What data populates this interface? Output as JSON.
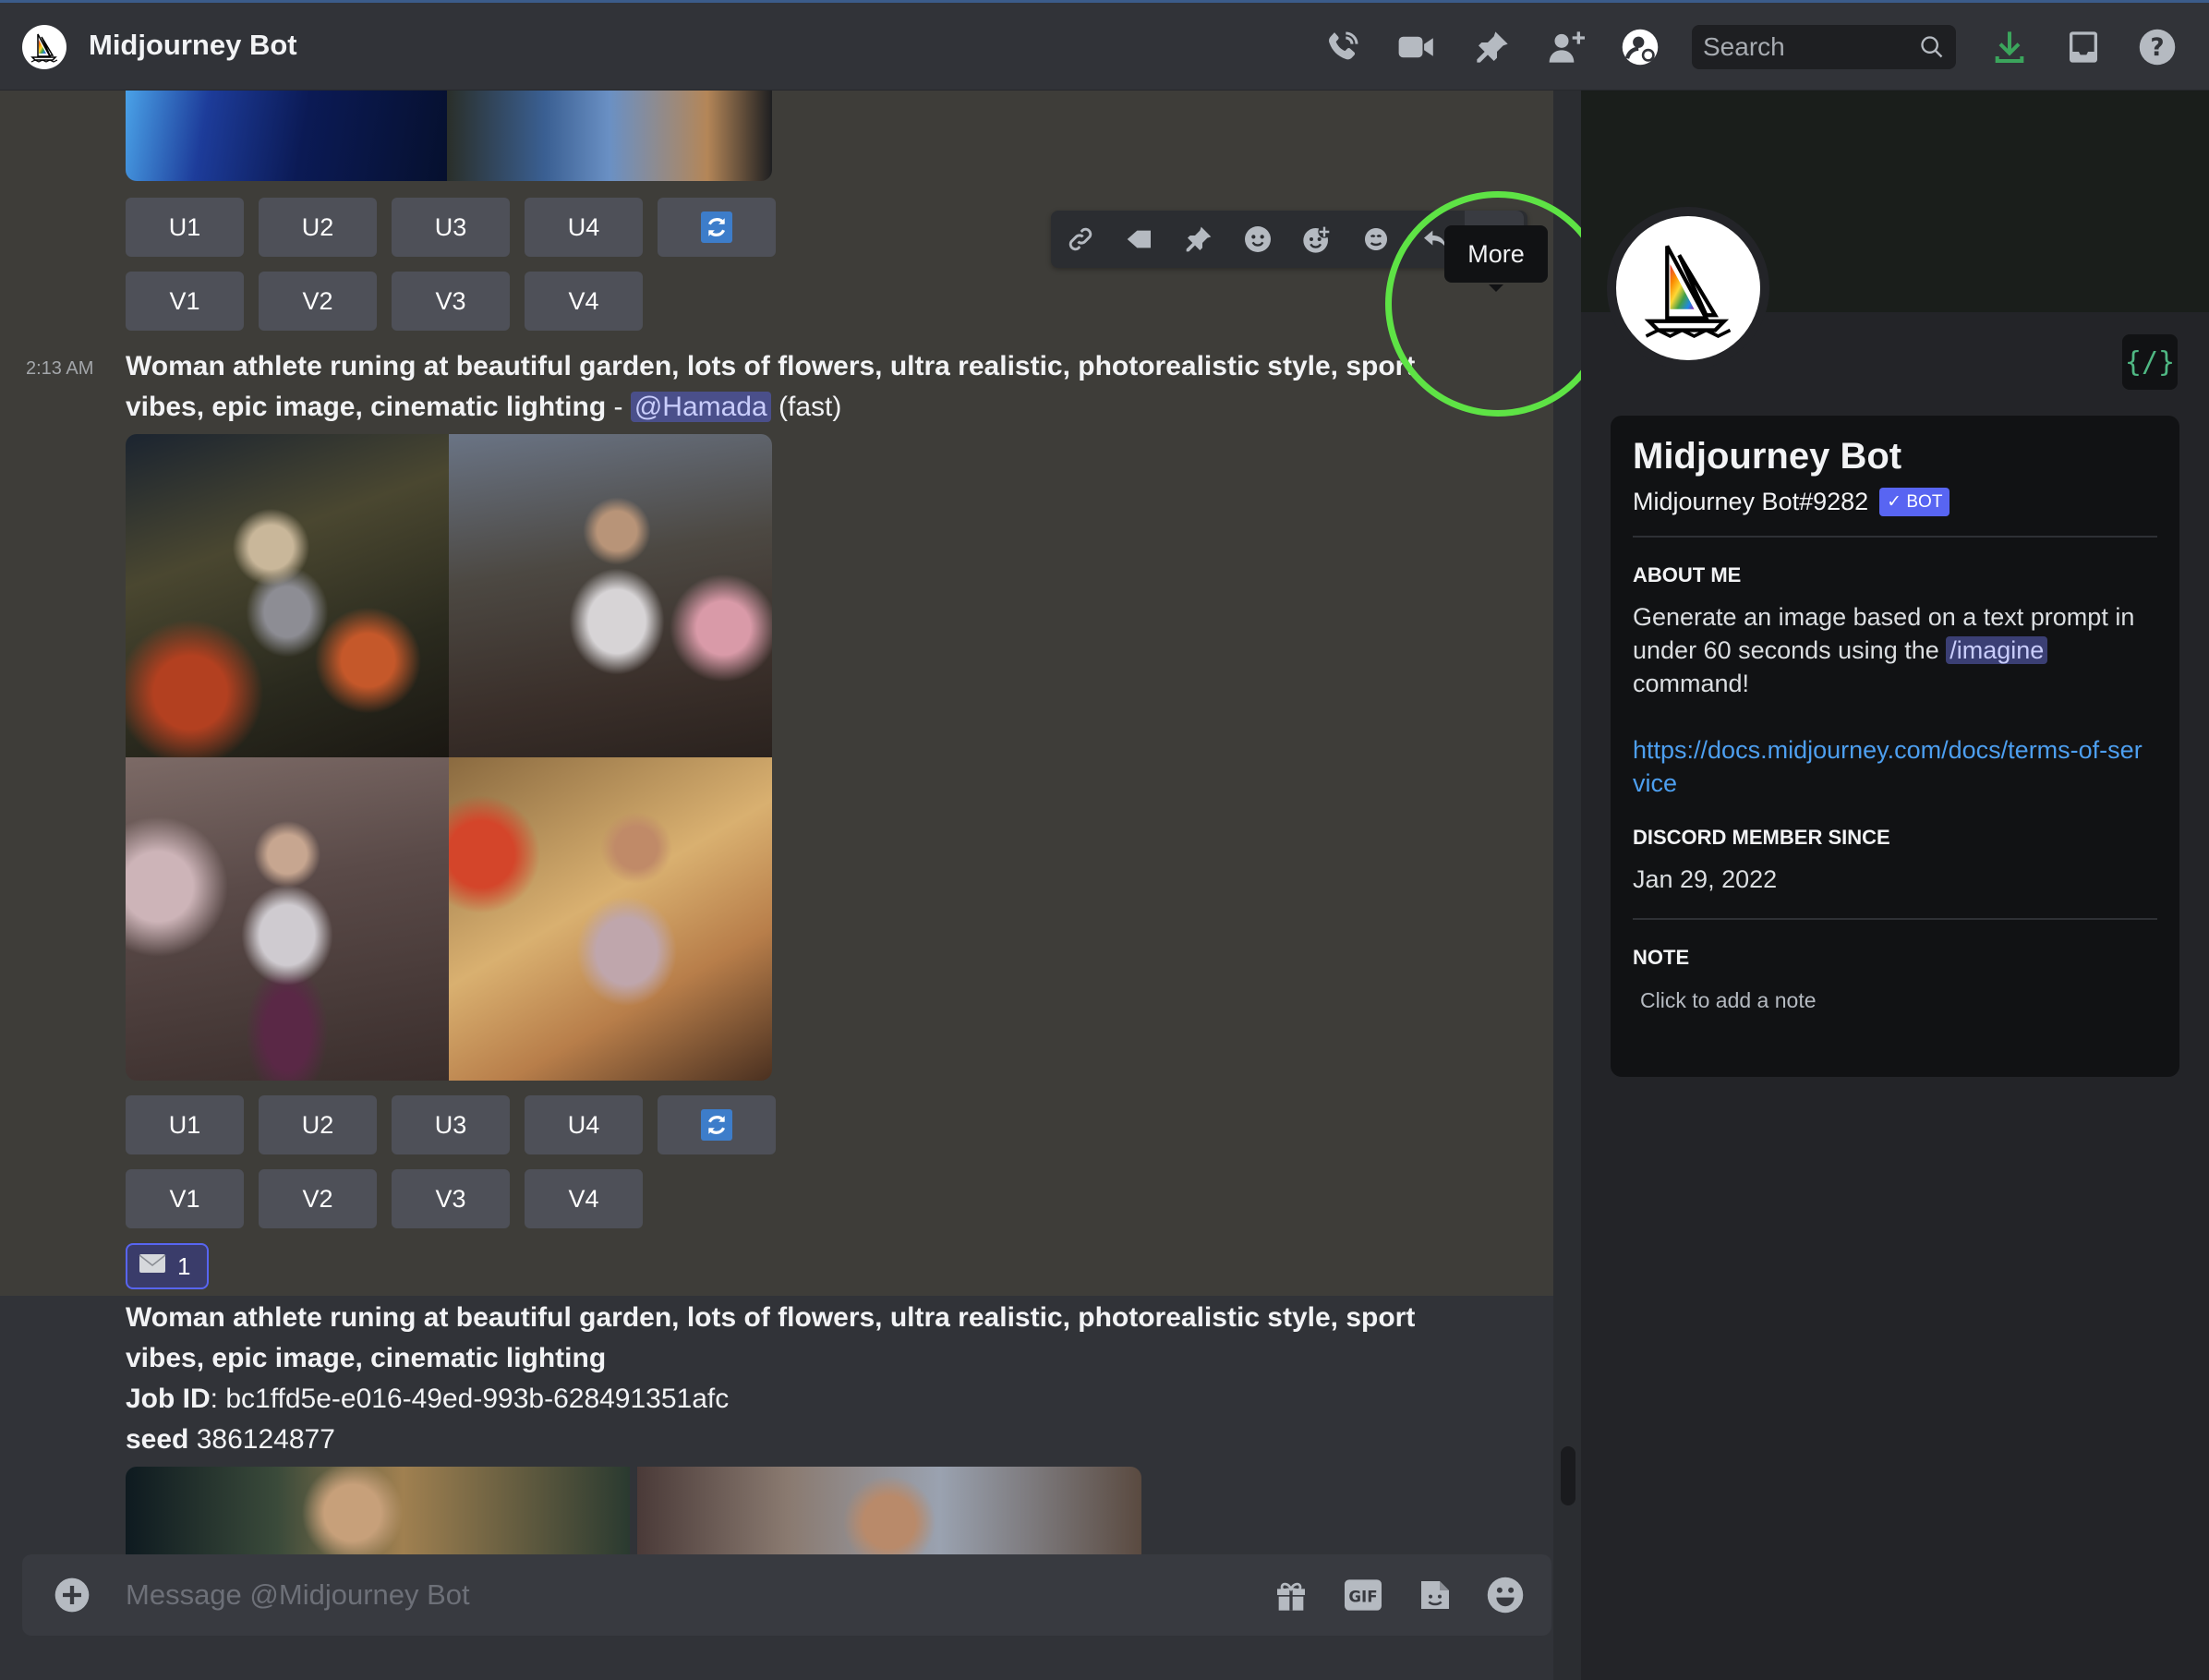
{
  "header": {
    "title": "Midjourney Bot",
    "search_placeholder": "Search",
    "icons": [
      "voice-call-icon",
      "video-call-icon",
      "pinned-messages-icon",
      "add-friend-icon",
      "user-profile-icon",
      "download-icon",
      "inbox-icon",
      "help-icon"
    ],
    "accent_download": "#3ba55c"
  },
  "messages": [
    {
      "id": "prev",
      "buttons_upscale": [
        "U1",
        "U2",
        "U3",
        "U4"
      ],
      "buttons_variation": [
        "V1",
        "V2",
        "V3",
        "V4"
      ],
      "reroll_icon": "reroll-icon"
    },
    {
      "id": "current",
      "timestamp": "2:13 AM",
      "prompt_line1": "Woman athlete runing at beautiful garden, lots of flowers, ultra realistic, photorealistic style, sport",
      "prompt_line2": "vibes, epic image, cinematic lighting",
      "separator": " - ",
      "mention": "@Hamada",
      "mode": "(fast)",
      "buttons_upscale": [
        "U1",
        "U2",
        "U3",
        "U4"
      ],
      "buttons_variation": [
        "V1",
        "V2",
        "V3",
        "V4"
      ],
      "reaction": {
        "icon": "envelope-icon",
        "count": "1"
      }
    },
    {
      "id": "next",
      "prompt_line1": "Woman athlete runing at beautiful garden, lots of flowers, ultra realistic, photorealistic style, sport",
      "prompt_line2": "vibes, epic image, cinematic lighting",
      "job_label": "Job ID",
      "job_id": ": bc1ffd5e-e016-49ed-993b-628491351afc",
      "seed_label": "seed",
      "seed": " 386124877"
    }
  ],
  "hover_toolbar": {
    "icons": [
      "copy-link-icon",
      "mark-unread-icon",
      "pin-icon",
      "add-reaction-icon",
      "super-reaction-icon",
      "apps-icon",
      "reply-icon",
      "more-icon"
    ],
    "tooltip": "More"
  },
  "composer": {
    "placeholder": "Message @Midjourney Bot",
    "icons": [
      "attach-plus-icon",
      "gift-icon",
      "gif-icon",
      "sticker-icon",
      "emoji-icon"
    ],
    "gif_label": "GIF"
  },
  "profile": {
    "name": "Midjourney Bot",
    "tag": "Midjourney Bot#9282",
    "bot_badge": "✓ BOT",
    "dev_badge": "{/}",
    "about_heading": "ABOUT ME",
    "about_pre": "Generate an image based on a text prompt in under 60 seconds using the ",
    "about_cmd": "/imagine",
    "about_post": " command!",
    "link": "https://docs.midjourney.com/docs/terms-of-service",
    "member_since_heading": "DISCORD MEMBER SINCE",
    "member_since": "Jan 29, 2022",
    "note_heading": "NOTE",
    "note_placeholder": "Click to add a note"
  }
}
